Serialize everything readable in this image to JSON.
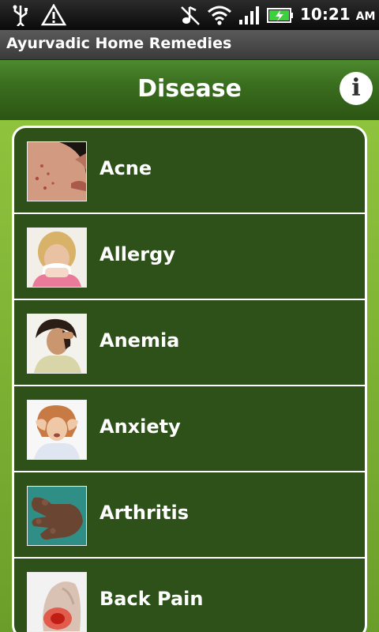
{
  "status_bar": {
    "icons": [
      "usb-icon",
      "warning-icon",
      "mute-icon",
      "wifi-icon",
      "signal-icon",
      "battery-charging-icon"
    ],
    "time": "10:21",
    "ampm": "AM"
  },
  "app": {
    "title": "Ayurvadic Home Remedies"
  },
  "header": {
    "title": "Disease",
    "info_icon": "info-icon",
    "info_glyph": "i"
  },
  "diseases": [
    {
      "label": "Acne"
    },
    {
      "label": "Allergy"
    },
    {
      "label": "Anemia"
    },
    {
      "label": "Anxiety"
    },
    {
      "label": "Arthritis"
    },
    {
      "label": "Back Pain"
    }
  ],
  "colors": {
    "header_green": "#3a6e1f",
    "list_bg": "#2d5118",
    "content_bg": "#8fc33d"
  }
}
